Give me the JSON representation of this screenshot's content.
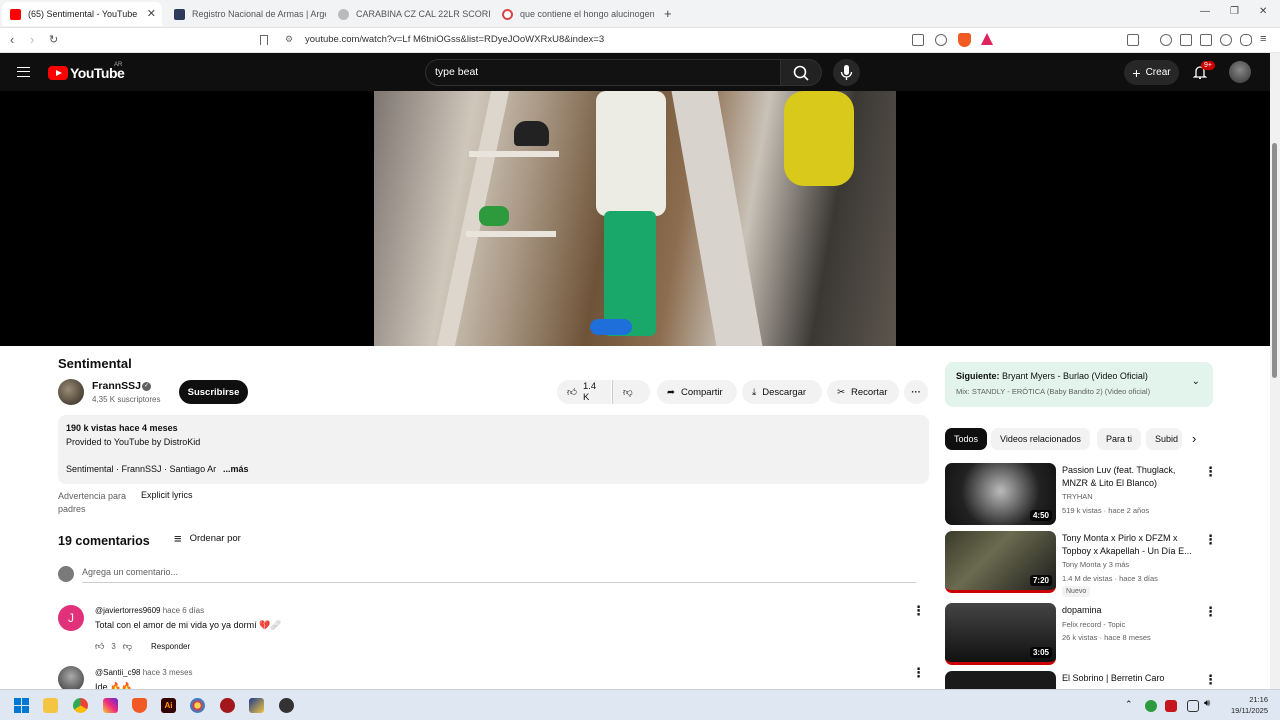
{
  "browser": {
    "tabs": [
      {
        "label": "(65) Sentimental - YouTube",
        "active": true
      },
      {
        "label": "Registro Nacional de Armas | Argent"
      },
      {
        "label": "CARABINA CZ CAL 22LR SCORPION"
      },
      {
        "label": "que contiene el hongo alucinogeno"
      }
    ],
    "url": "youtube.com/watch?v=Lf M6tniOGss&list=RDyeJOoWXRxU8&index=3"
  },
  "youtube": {
    "logo_text": "YouTube",
    "country": "AR",
    "search_value": "type beat",
    "create_label": "Crear",
    "notif_badge": "9+"
  },
  "video": {
    "title": "Sentimental",
    "channel": "FrannSSJ",
    "subscribers": "4,35 K suscriptores",
    "subscribe_label": "Suscribirse",
    "likes": "1.4 K",
    "share_label": "Compartir",
    "download_label": "Descargar",
    "clip_label": "Recortar",
    "description": {
      "stats": "190 k vistas  hace 4 meses",
      "line2": "Provided to YouTube by DistroKid",
      "line3": "Sentimental · FrannSSJ · Santiago Ar",
      "more": "...más"
    },
    "parental_label": "Advertencia para padres",
    "parental_value": "Explicit lyrics"
  },
  "comments": {
    "count_label": "19 comentarios",
    "sort_label": "Ordenar por",
    "add_placeholder": "Agrega un comentario...",
    "items": [
      {
        "author": "@javiertorres9609",
        "time": "hace 6 días",
        "text": "Total con el amor de mi vida yo ya dormí 💔🩹",
        "likes": "3",
        "reply": "Responder",
        "avatar_letter": "J"
      },
      {
        "author": "@Santii_c98",
        "time": "hace 3 meses",
        "text": "Ide 🔥🔥"
      }
    ]
  },
  "sidebar": {
    "next_title": "Siguiente:",
    "next_video": "Bryant Myers - Burlao (Video Oficial)",
    "next_mix": "Mix: STANDLY - ERÓTICA (Baby Bandito 2) (Video oficial)",
    "chips": [
      "Todos",
      "Videos relacionados",
      "Para ti",
      "Subid"
    ],
    "videos": [
      {
        "title": "Passion Luv (feat. Thuglack, MNZR & Lito El Blanco)",
        "channel": "TRYHAN",
        "meta": "519 k vistas · hace 2 años",
        "duration": "4:50"
      },
      {
        "title": "Tony Monta x Pirlo x DFZM x Topboy x Akapellah - Un Día E...",
        "channel": "Tony Monta  y 3 más",
        "meta": "1.4 M de vistas · hace 3 días",
        "badge": "Nuevo",
        "duration": "7:20"
      },
      {
        "title": "dopamina",
        "channel": "Felix record - Topic",
        "meta": "26 k vistas · hace 8 meses",
        "duration": "3:05"
      },
      {
        "title": "El Sobrino | Berretin Caro",
        "channel": "",
        "meta": "",
        "duration": ""
      }
    ]
  },
  "taskbar": {
    "time": "21:16",
    "date": "19/11/2025"
  },
  "colors": {
    "youtube_red": "#ff0000",
    "next_bg": "#e3f4ec",
    "header_bg": "#0f0f0f"
  }
}
